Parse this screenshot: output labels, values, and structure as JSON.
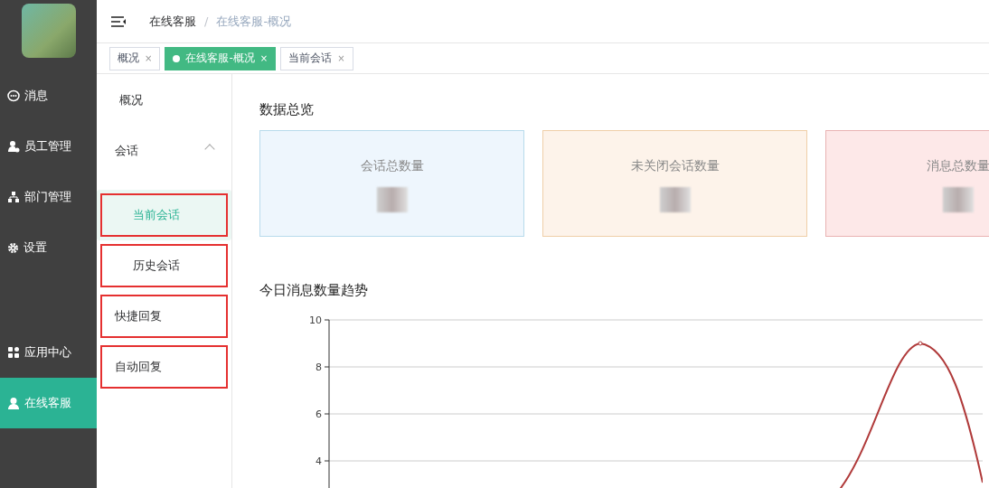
{
  "sidebar": {
    "items": [
      {
        "label": "消息",
        "selected": false
      },
      {
        "label": "员工管理",
        "selected": false
      },
      {
        "label": "部门管理",
        "selected": false
      },
      {
        "label": "设置",
        "selected": false
      },
      {
        "label": "应用中心",
        "selected": false
      },
      {
        "label": "在线客服",
        "selected": true
      }
    ]
  },
  "breadcrumb": {
    "items": [
      "在线客服",
      "在线客服-概况"
    ],
    "separator": "/"
  },
  "tabs": [
    {
      "label": "概况",
      "close": "×",
      "selected": false
    },
    {
      "label": "在线客服-概况",
      "close": "×",
      "selected": true
    },
    {
      "label": "当前会话",
      "close": "×",
      "selected": false
    }
  ],
  "submenu": [
    {
      "label": "概况",
      "selected": false,
      "annotated": false
    },
    {
      "label": "会话",
      "expanded": true,
      "selected": false,
      "annotated": false,
      "children": [
        {
          "label": "当前会话",
          "selected": true,
          "annotated": true
        },
        {
          "label": "历史会话",
          "selected": false,
          "annotated": true
        }
      ]
    },
    {
      "label": "快捷回复",
      "selected": false,
      "annotated": true
    },
    {
      "label": "自动回复",
      "selected": false,
      "annotated": true
    }
  ],
  "overview": {
    "title": "数据总览",
    "cards": [
      {
        "label": "会话总数量",
        "color": "#eef6fd"
      },
      {
        "label": "未关闭会话数量",
        "color": "#fdf3ea"
      },
      {
        "label": "消息总数量",
        "color": "#fde8e8"
      }
    ]
  },
  "trend": {
    "title": "今日消息数量趋势",
    "y_axis_labels": [
      "10",
      "8",
      "6",
      "4"
    ]
  }
}
